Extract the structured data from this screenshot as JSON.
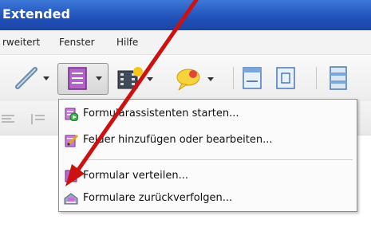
{
  "window": {
    "title": "Extended"
  },
  "menubar": {
    "items": [
      "rweitert",
      "Fenster",
      "Hilfe"
    ]
  },
  "form_menu": {
    "items": [
      {
        "label": "Formularassistenten starten...",
        "icon": "form-wizard-icon"
      },
      {
        "label": "Felder hinzufügen oder bearbeiten...",
        "icon": "edit-fields-icon"
      },
      {
        "label": "Formular verteilen...",
        "icon": "distribute-form-icon"
      },
      {
        "label": "Formulare zurückverfolgen...",
        "icon": "track-forms-icon"
      }
    ]
  },
  "annotation": {
    "color": "#cc1111"
  }
}
